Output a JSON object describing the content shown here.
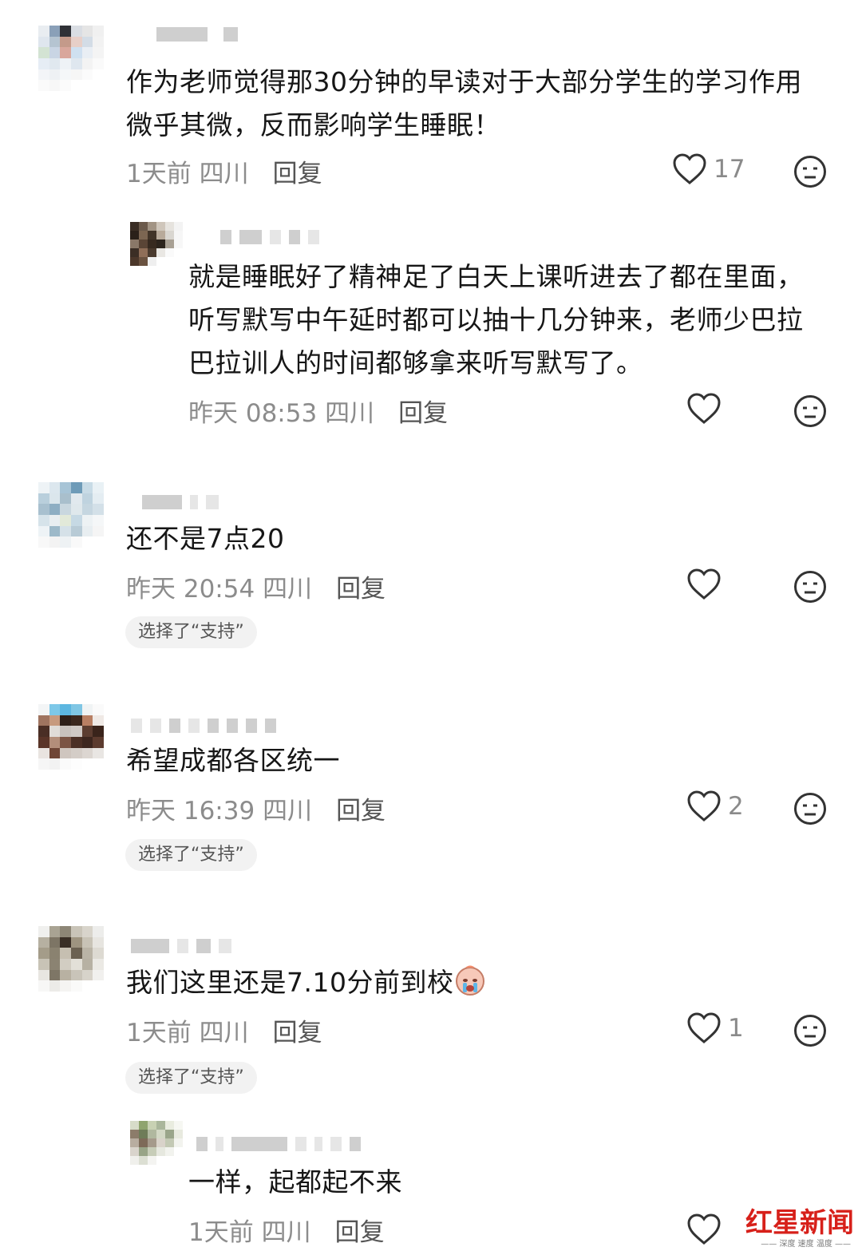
{
  "comments": [
    {
      "text": "作为老师觉得那30分钟的早读对于大部分学生的学习作用\n微乎其微，反而影响学生睡眠！",
      "time": "1天前",
      "location": "四川",
      "reply": "回复",
      "likes": "17"
    },
    {
      "text": "就是睡眠好了精神足了白天上课听进去了都在里面，\n听写默写中午延时都可以抽十几分钟来，老师少巴拉\n巴拉训人的时间都够拿来听写默写了。",
      "time": "昨天 08:53",
      "location": "四川",
      "reply": "回复",
      "likes": ""
    },
    {
      "text": "还不是7点20",
      "time": "昨天 20:54",
      "location": "四川",
      "reply": "回复",
      "likes": "",
      "chip": "选择了“支持”"
    },
    {
      "text": "希望成都各区统一",
      "time": "昨天 16:39",
      "location": "四川",
      "reply": "回复",
      "likes": "2",
      "chip": "选择了“支持”"
    },
    {
      "text": "我们这里还是7.10分前到校",
      "emoji": "crying-face-emoji",
      "time": "1天前",
      "location": "四川",
      "reply": "回复",
      "likes": "1",
      "chip": "选择了“支持”"
    },
    {
      "text": "一样，起都起不来",
      "time": "1天前",
      "location": "四川",
      "reply": "回复",
      "likes": ""
    }
  ],
  "watermark": {
    "logo": "红星新闻",
    "sub": "—— 深度 速度 温度 ——"
  },
  "colors": {
    "meta": "#8c8c8c",
    "chip_bg": "#f2f2f2",
    "watermark_red": "#d7201a"
  }
}
